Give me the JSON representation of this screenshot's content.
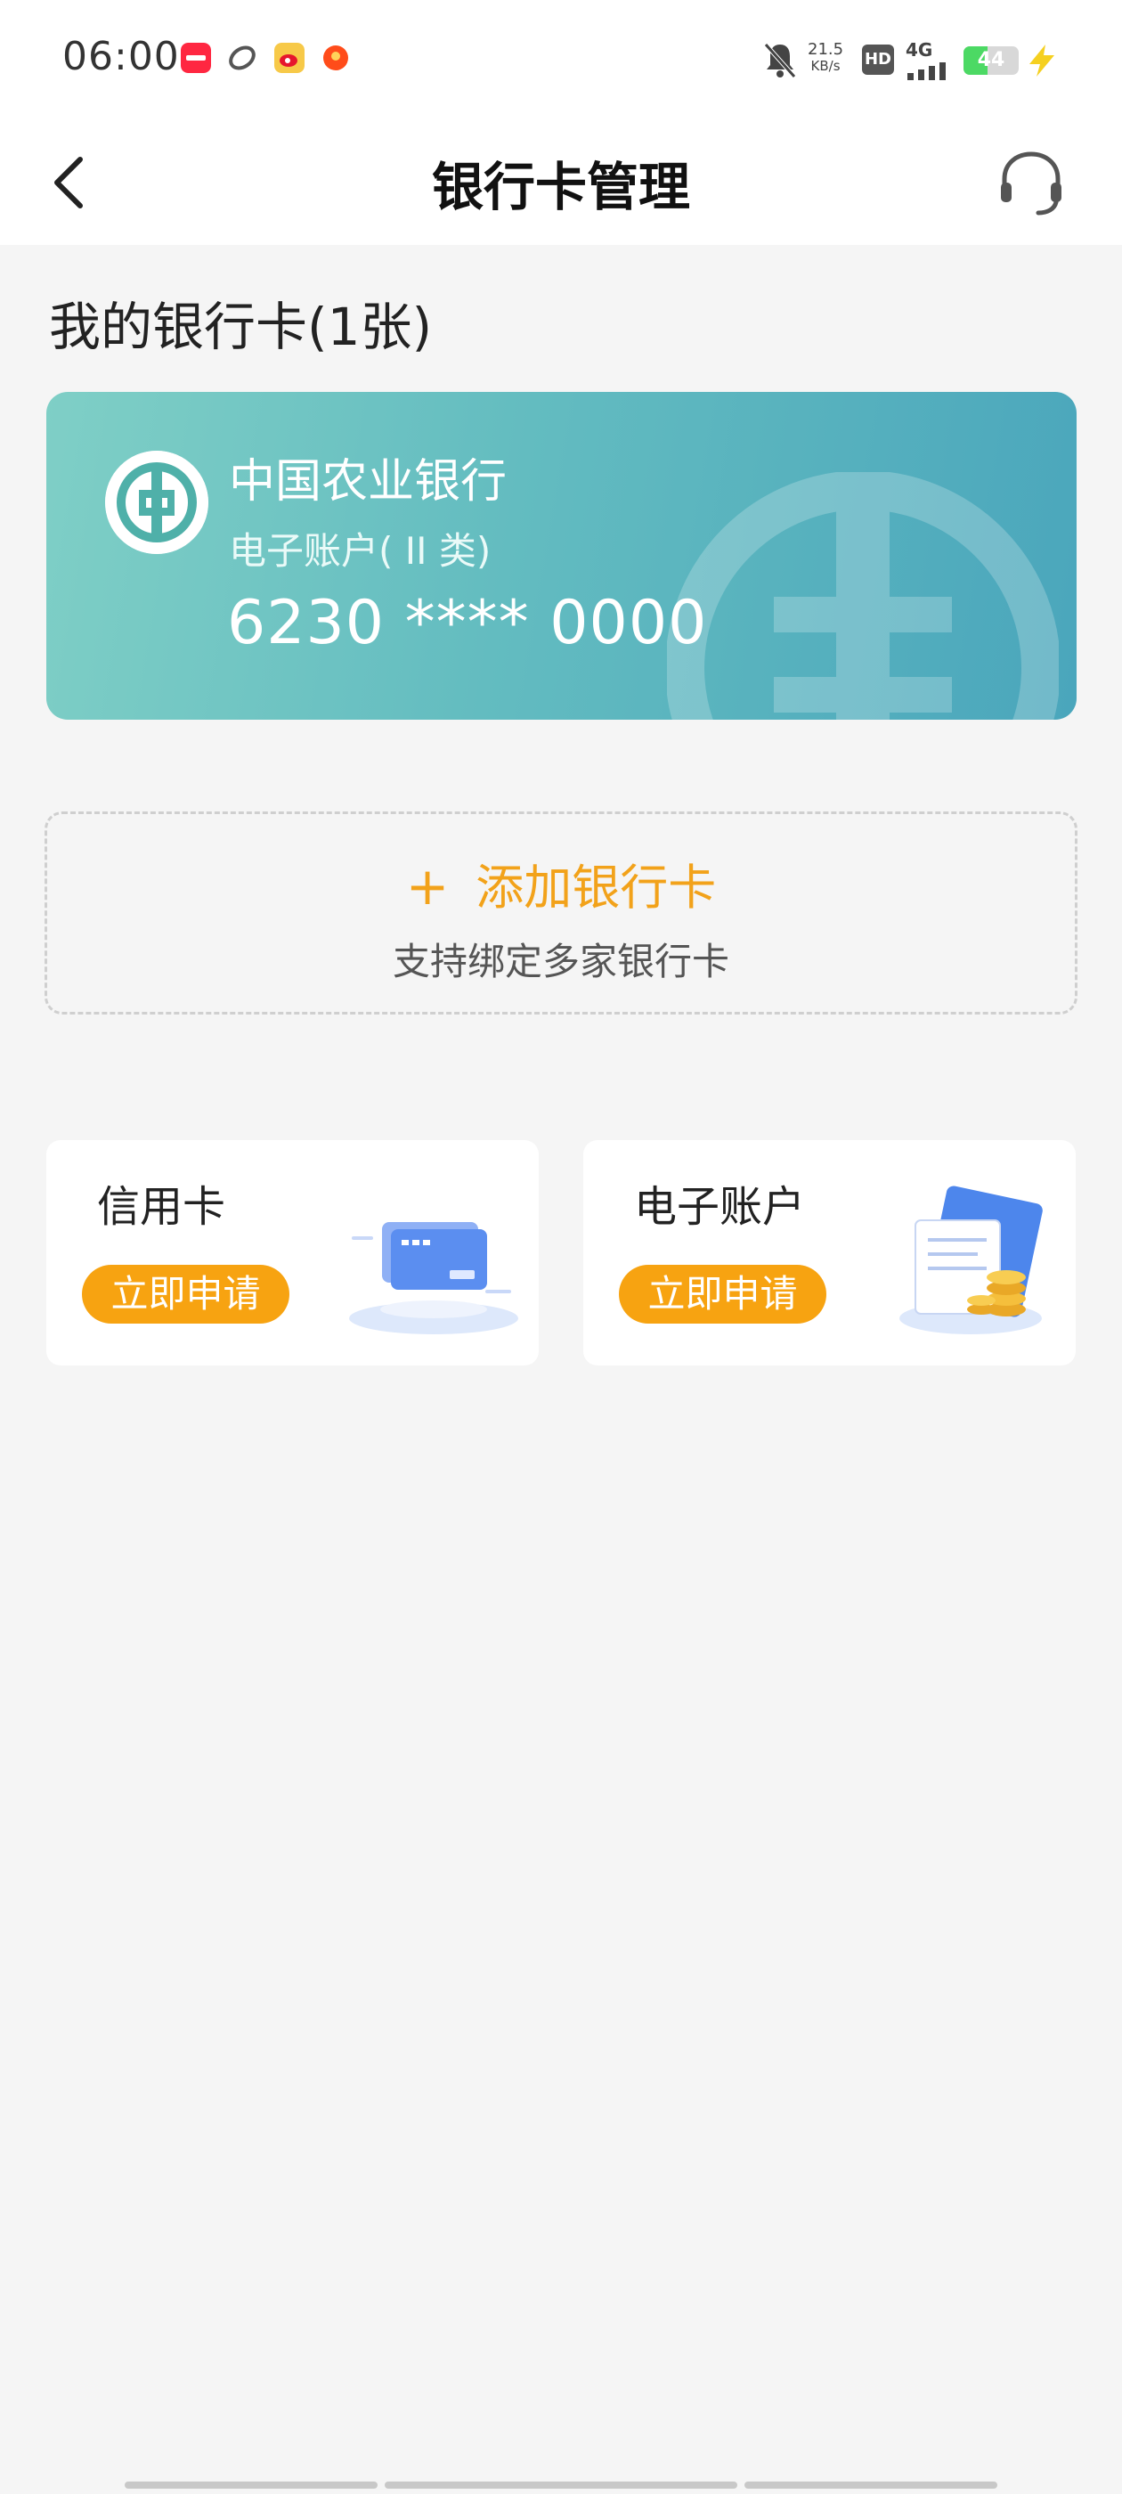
{
  "status_bar": {
    "time": "06:00",
    "speed_value": "21.5",
    "speed_unit": "KB/s",
    "hd": "HD",
    "network": "4G",
    "battery": "44",
    "battery_level": 0.44,
    "icons": [
      "xiaohongshu-app-icon",
      "link-app-icon",
      "weibo-app-icon",
      "taobao-app-icon",
      "mute-bell-icon",
      "signal-icon",
      "charging-icon"
    ]
  },
  "nav": {
    "title": "银行卡管理",
    "back_icon": "chevron-left-icon",
    "service_icon": "headset-icon"
  },
  "section_title": "我的银行卡(1张)",
  "bank_card": {
    "bank_name": "中国农业银行",
    "account_type": "电子账户( II 类)",
    "card_number": "6230 **** 0000",
    "logo_icon": "abc-bank-logo-icon",
    "colors": {
      "gradient_start": "#7fcfc6",
      "gradient_end": "#4aa6bc"
    }
  },
  "add_card": {
    "plus": "+",
    "label": "添加银行卡",
    "subtitle": "支持绑定多家银行卡",
    "accent_color": "#f2a21a"
  },
  "tiles": [
    {
      "title": "信用卡",
      "button": "立即申请",
      "illustration": "credit-card-illustration-icon"
    },
    {
      "title": "电子账户",
      "button": "立即申请",
      "illustration": "electronic-account-illustration-icon"
    }
  ],
  "colors": {
    "button": "#f7a311",
    "background": "#f5f5f5"
  }
}
